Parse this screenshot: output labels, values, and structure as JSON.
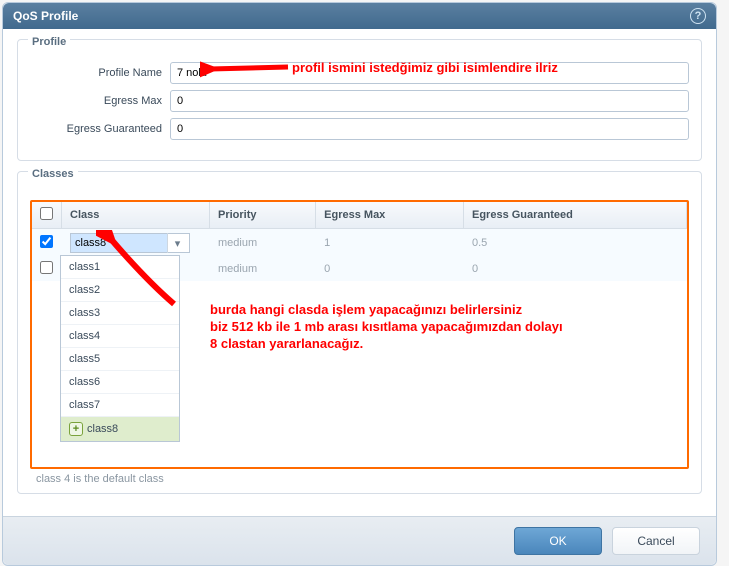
{
  "dialog": {
    "title": "QoS Profile"
  },
  "profile": {
    "legend": "Profile",
    "name_label": "Profile Name",
    "name_value": "7 nolu",
    "egress_max_label": "Egress Max",
    "egress_max_value": "0",
    "egress_gtd_label": "Egress Guaranteed",
    "egress_gtd_value": "0"
  },
  "classes": {
    "legend": "Classes",
    "headers": {
      "class": "Class",
      "priority": "Priority",
      "egress_max": "Egress Max",
      "egress_gtd": "Egress Guaranteed"
    },
    "rows": [
      {
        "class": "class8",
        "priority": "medium",
        "egress_max": "1",
        "egress_gtd": "0.5",
        "checked": true,
        "editing": true
      },
      {
        "class": "",
        "priority": "medium",
        "egress_max": "0",
        "egress_gtd": "0",
        "checked": false,
        "editing": false
      }
    ],
    "dropdown": {
      "items": [
        "class1",
        "class2",
        "class3",
        "class4",
        "class5",
        "class6",
        "class7"
      ],
      "add_item": "class8"
    },
    "hint": "class 4 is the default class"
  },
  "buttons": {
    "ok": "OK",
    "cancel": "Cancel"
  },
  "annotations": {
    "a1": "profil ismini istedğimiz gibi isimlendire ilriz",
    "a2_l1": "burda hangi clasda işlem yapacağınızı belirlersiniz",
    "a2_l2": "biz 512 kb ile 1 mb arası kısıtlama yapacağımızdan dolayı",
    "a2_l3": "8 clastan yararlanacağız."
  }
}
